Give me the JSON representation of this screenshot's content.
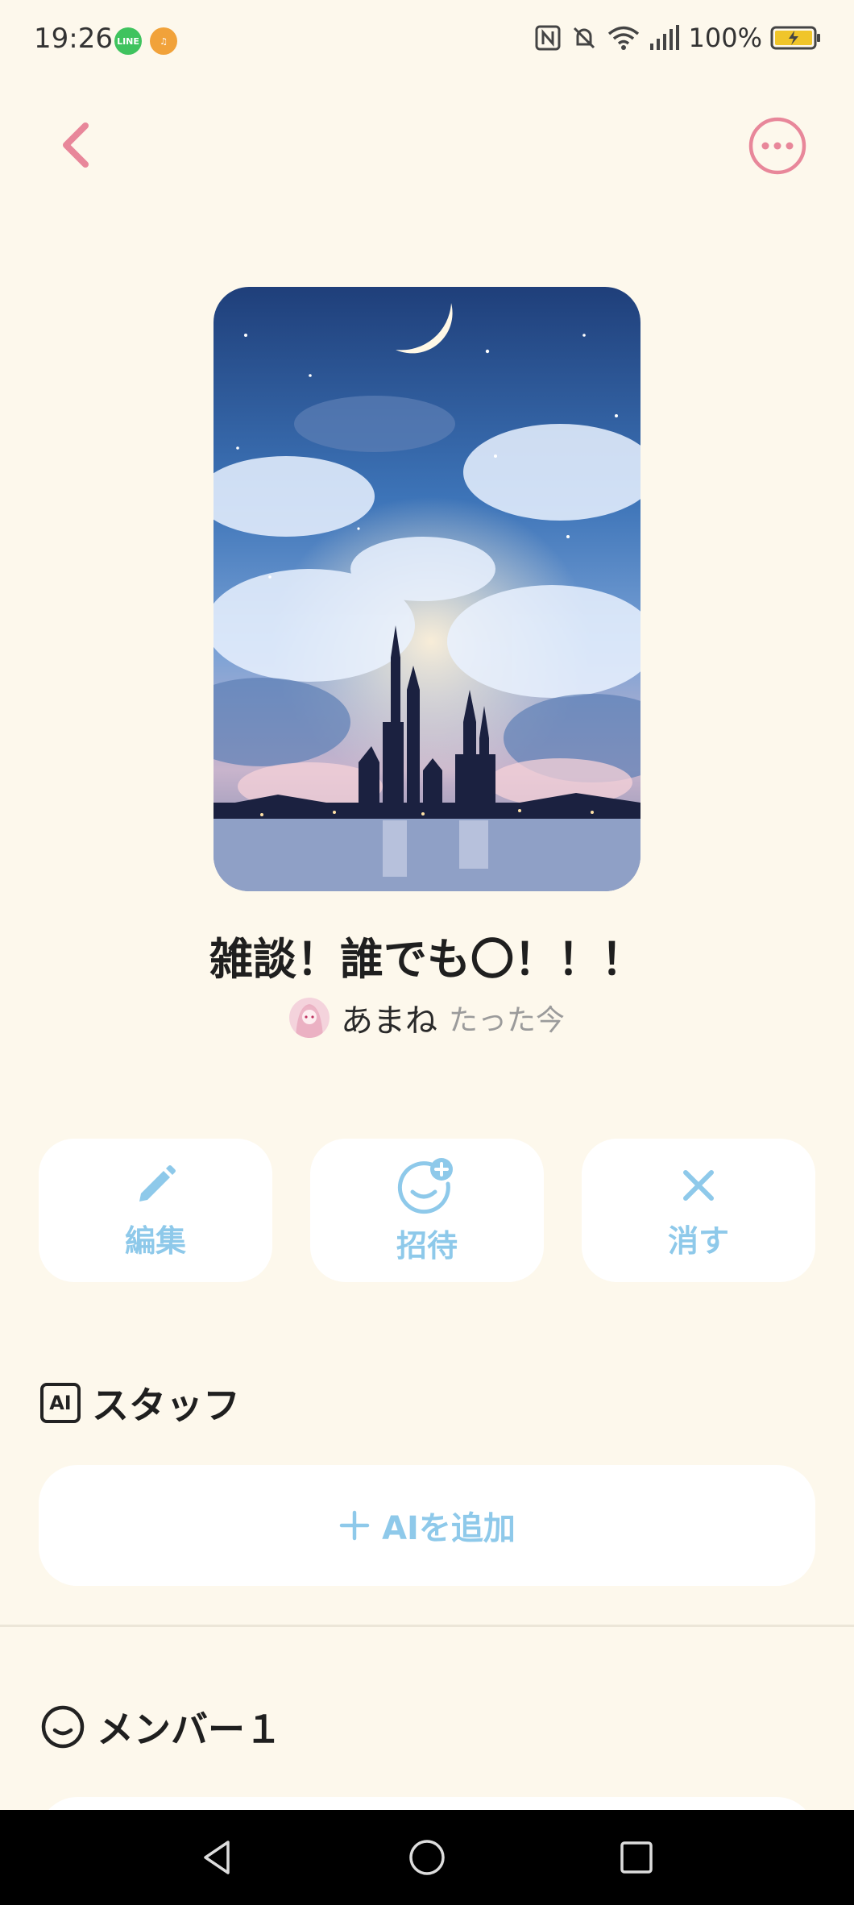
{
  "status_bar": {
    "time": "19:26",
    "battery": "100%",
    "icons": [
      "line-icon",
      "music-icon",
      "nfc-icon",
      "mute-icon",
      "wifi-icon",
      "signal-icon",
      "battery-charging-icon"
    ]
  },
  "header": {
    "back_icon": "chevron-left-icon",
    "more_icon": "more-horizontal-icon"
  },
  "room": {
    "title": "雑談！誰でも〇！！！",
    "creator": "あまね",
    "timestamp": "たった今"
  },
  "actions": [
    {
      "label": "編集",
      "icon": "pencil-icon"
    },
    {
      "label": "招待",
      "icon": "invite-smile-plus-icon"
    },
    {
      "label": "消す",
      "icon": "close-icon"
    }
  ],
  "staff_section": {
    "title": "スタッフ",
    "icon_text": "AI",
    "add_button": "AIを追加"
  },
  "members_section": {
    "title": "メンバー１"
  },
  "colors": {
    "background": "#fdf8ec",
    "accent_pink": "#e8879a",
    "accent_blue": "#8ec9ea"
  }
}
